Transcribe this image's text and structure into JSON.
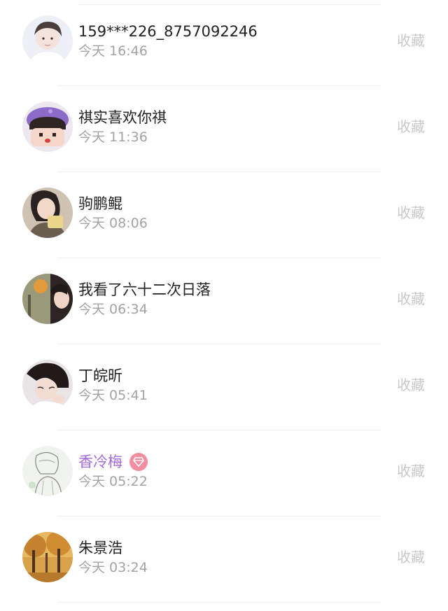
{
  "items": [
    {
      "name": "159***226_8757092246",
      "time": "今天 16:46",
      "action": "收藏",
      "avatar": "avatar-boy-portrait",
      "vip": false
    },
    {
      "name": "祺实喜欢你祺",
      "time": "今天 11:36",
      "action": "收藏",
      "avatar": "avatar-cartoon-purple-hat",
      "vip": false
    },
    {
      "name": "驹鹏鲲",
      "time": "今天 08:06",
      "action": "收藏",
      "avatar": "avatar-girl-photo",
      "vip": false
    },
    {
      "name": "我看了六十二次日落",
      "time": "今天 06:34",
      "action": "收藏",
      "avatar": "avatar-scenery-girl",
      "vip": false
    },
    {
      "name": "丁皖昕",
      "time": "今天 05:41",
      "action": "收藏",
      "avatar": "avatar-girl-sleeping",
      "vip": false
    },
    {
      "name": "香冷梅",
      "time": "今天 05:22",
      "action": "收藏",
      "avatar": "avatar-sketch-drawing",
      "vip": true
    },
    {
      "name": "朱景浩",
      "time": "今天 03:24",
      "action": "收藏",
      "avatar": "avatar-autumn-trees",
      "vip": false
    }
  ],
  "colors": {
    "name_text": "#222222",
    "vip_name_text": "#a56bd9",
    "time_text": "#a3a3a3",
    "action_text": "#c8c8c8",
    "vip_badge": "#f18ea2",
    "divider": "#f0f0f0"
  },
  "icons": {
    "vip_badge": "diamond-icon"
  }
}
